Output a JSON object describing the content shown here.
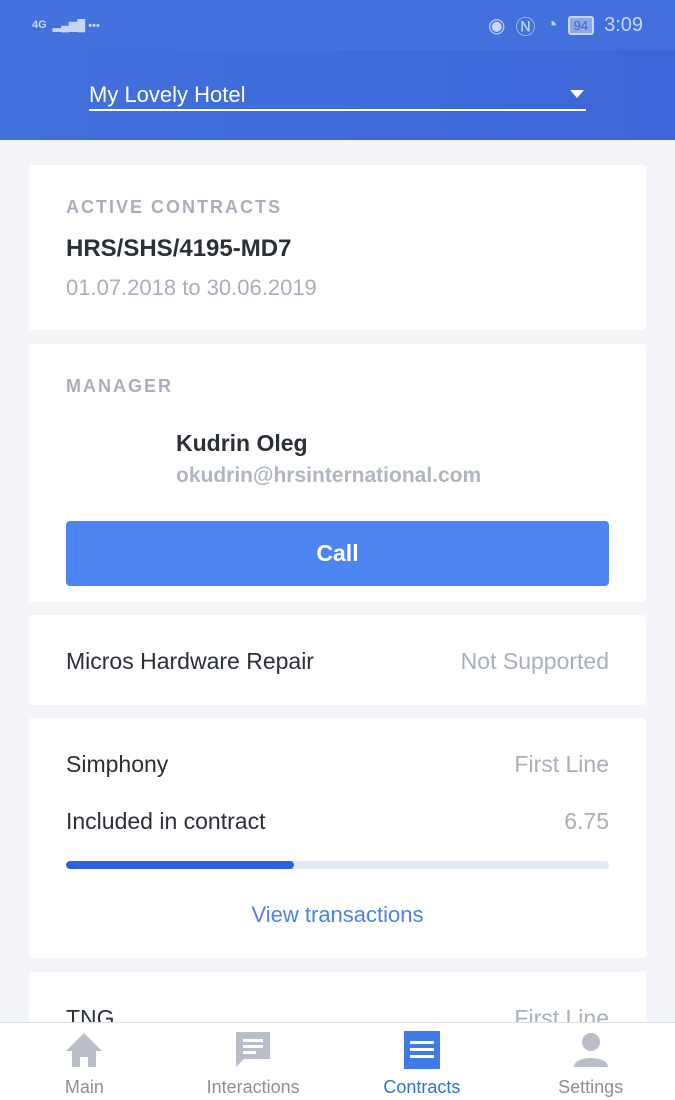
{
  "status_bar": {
    "network": "4G",
    "time": "3:09",
    "battery": "94"
  },
  "header": {
    "hotel": "My Lovely Hotel"
  },
  "active_contracts": {
    "label": "ACTIVE CONTRACTS",
    "number": "HRS/SHS/4195-MD7",
    "period": "01.07.2018 to 30.06.2019"
  },
  "manager": {
    "label": "MANAGER",
    "name": "Kudrin Oleg",
    "email": "okudrin@hrsinternational.com",
    "call_label": "Call"
  },
  "services": [
    {
      "name": "Micros Hardware Repair",
      "status": "Not Supported"
    },
    {
      "name": "Simphony",
      "status": "First Line",
      "included_label": "Included in contract",
      "included_value": "6.75",
      "progress_percent": 42,
      "link": "View transactions"
    },
    {
      "name": "TNG",
      "status": "First Line"
    }
  ],
  "nav": {
    "items": [
      {
        "label": "Main",
        "icon": "home-icon"
      },
      {
        "label": "Interactions",
        "icon": "chat-icon"
      },
      {
        "label": "Contracts",
        "icon": "receipt-icon",
        "active": true
      },
      {
        "label": "Settings",
        "icon": "person-icon"
      }
    ]
  },
  "colors": {
    "primary": "#4270dd",
    "accent": "#4d85f0",
    "active_nav": "#2f72d6"
  }
}
